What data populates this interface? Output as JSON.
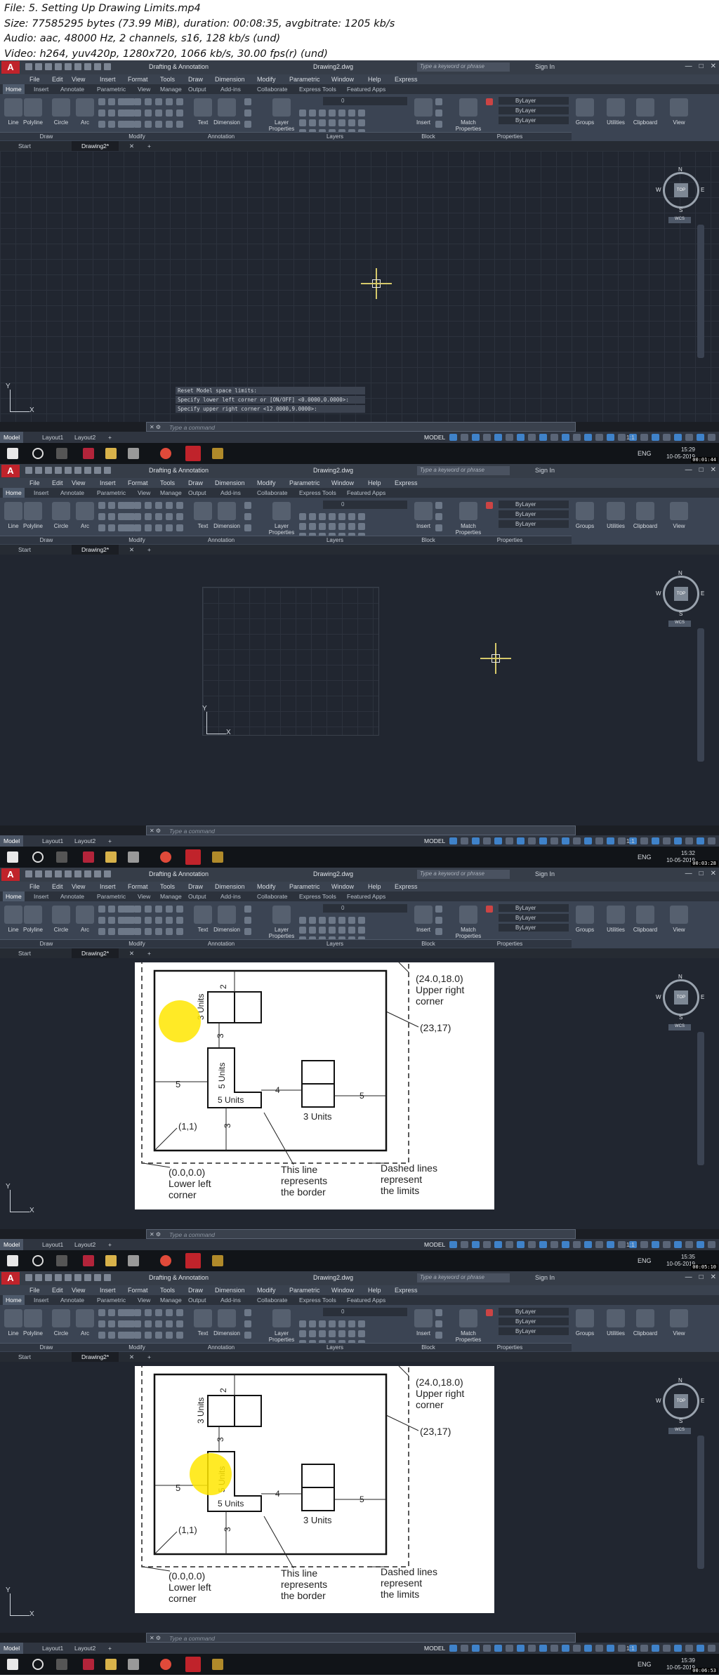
{
  "video_info": {
    "file": "File: 5. Setting Up Drawing Limits.mp4",
    "size": "Size: 77585295 bytes (73.99 MiB), duration: 00:08:35, avgbitrate: 1205 kb/s",
    "audio": "Audio: aac, 48000 Hz, 2 channels, s16, 128 kb/s (und)",
    "video": "Video: h264, yuv420p, 1280x720, 1066 kb/s, 30.00 fps(r) (und)"
  },
  "app": {
    "logo": "A",
    "workspace": "Drafting & Annotation",
    "doc_title": "Drawing2.dwg",
    "keyword_placeholder": "Type a keyword or phrase",
    "sign_in": "Sign In",
    "menu": [
      "File",
      "Edit",
      "View",
      "Insert",
      "Format",
      "Tools",
      "Draw",
      "Dimension",
      "Modify",
      "Parametric",
      "Window",
      "Help",
      "Express"
    ],
    "ribbon_tabs": [
      "Home",
      "Insert",
      "Annotate",
      "Parametric",
      "View",
      "Manage",
      "Output",
      "Add-ins",
      "Collaborate",
      "Express Tools",
      "Featured Apps"
    ],
    "tools": {
      "line": "Line",
      "polyline": "Polyline",
      "circle": "Circle",
      "arc": "Arc",
      "text": "Text",
      "dimension": "Dimension",
      "layer_properties": "Layer Properties",
      "insert": "Insert",
      "match_properties": "Match Properties",
      "groups": "Groups",
      "utilities": "Utilities",
      "clipboard": "Clipboard",
      "view": "View"
    },
    "panels": {
      "draw": "Draw",
      "modify": "Modify",
      "annotation": "Annotation",
      "layers": "Layers",
      "block": "Block",
      "properties": "Properties"
    },
    "layer_value": "0",
    "bylayer": "ByLayer",
    "doc_tabs": {
      "start": "Start",
      "drawing": "Drawing2*"
    },
    "command_placeholder": "Type a command",
    "layout_tabs": [
      "Model",
      "Layout1",
      "Layout2"
    ],
    "status_model": "MODEL",
    "scale": "1:1",
    "lang": "ENG",
    "ucs_y": "Y",
    "ucs_x": "X",
    "viewcube": {
      "n": "N",
      "s": "S",
      "e": "E",
      "w": "W",
      "top": "TOP",
      "wcs": "WCS"
    }
  },
  "frames": [
    {
      "time": "15:29",
      "date": "10-05-2019",
      "timestamp": "00:01:44",
      "command_history": [
        "Reset Model space limits:",
        "Specify lower left corner or [ON/OFF] <0.0000,0.0000>:",
        "Specify upper right corner <12.0000,9.0000>:"
      ]
    },
    {
      "time": "15:32",
      "date": "10-05-2019",
      "timestamp": "00:03:28"
    },
    {
      "time": "15:35",
      "date": "10-05-2019",
      "timestamp": "00:05:10"
    },
    {
      "time": "15:39",
      "date": "10-05-2019",
      "timestamp": "00:06:53"
    }
  ],
  "reference_diagram": {
    "upper_right_label": [
      "(24.0,18.0)",
      "Upper right",
      "corner"
    ],
    "inner_corner": "(23,17)",
    "lower_left_inner": "(1,1)",
    "lower_left_label": [
      "(0.0,0.0)",
      "Lower left",
      "corner"
    ],
    "border_label": [
      "This line",
      "represents",
      "the border"
    ],
    "limits_label": [
      "Dashed lines",
      "represent",
      "the limits"
    ],
    "dims": {
      "two": "2",
      "three_a": "3",
      "three_b": "3",
      "four": "4",
      "five_a": "5",
      "five_b": "5",
      "units_vert": "3 Units",
      "units_five_vert": "5 Units",
      "units_five_horiz": "5 Units",
      "units_three": "3 Units"
    }
  }
}
